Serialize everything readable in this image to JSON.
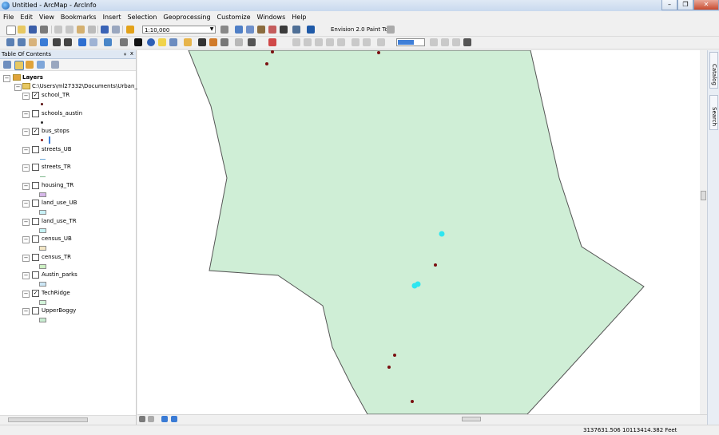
{
  "window": {
    "title": "Untitled - ArcMap - ArcInfo",
    "minimize": "–",
    "restore": "❐",
    "close": "✕"
  },
  "menu": [
    "File",
    "Edit",
    "View",
    "Bookmarks",
    "Insert",
    "Selection",
    "Geoprocessing",
    "Customize",
    "Windows",
    "Help"
  ],
  "toolbar": {
    "scale": "1:10,000",
    "paint_tool_label": "Envision 2.0 Paint Tool",
    "paint_color": "#3f7fd8"
  },
  "toc": {
    "title": "Table Of Contents",
    "pin": "ᵩ",
    "close": "x",
    "root": "Layers",
    "folder_path": "C:\\Users\\ml27332\\Documents\\Urban_F",
    "layers": [
      {
        "name": "school_TR",
        "checked": true,
        "symbol": "point",
        "color": "#5a0f0f"
      },
      {
        "name": "schools_austin",
        "checked": false,
        "symbol": "point",
        "color": "#2a2a2a"
      },
      {
        "name": "bus_stops",
        "checked": true,
        "symbol": "point",
        "color": "#8b1a1a"
      },
      {
        "name": "streets_UB",
        "checked": false,
        "symbol": "line",
        "color": "#6aa7d8"
      },
      {
        "name": "streets_TR",
        "checked": false,
        "symbol": "line",
        "color": "#7fb98d"
      },
      {
        "name": "housing_TR",
        "checked": false,
        "symbol": "fill",
        "color": "#d7b8ea"
      },
      {
        "name": "land_use_UB",
        "checked": false,
        "symbol": "fill",
        "color": "#c7f0f6"
      },
      {
        "name": "land_use_TR",
        "checked": false,
        "symbol": "fill",
        "color": "#c4f2f4"
      },
      {
        "name": "census_UB",
        "checked": false,
        "symbol": "fill",
        "color": "#f3e6c5"
      },
      {
        "name": "census_TR",
        "checked": false,
        "symbol": "fill",
        "color": "#cdf0c3"
      },
      {
        "name": "Austin_parks",
        "checked": false,
        "symbol": "fill",
        "color": "#cce6f5"
      },
      {
        "name": "TechRidge",
        "checked": true,
        "symbol": "fill",
        "color": "#d2f3d9"
      },
      {
        "name": "UpperBoggy",
        "checked": false,
        "symbol": "fill",
        "color": "#c7ecd0"
      }
    ]
  },
  "map": {
    "polygon_fill": "#cfeed6",
    "polygon_stroke": "#555555",
    "point_color": "#7a1010",
    "bus_stop_color": "#2ee6f0"
  },
  "dock": {
    "catalog": "Catalog",
    "search": "Search"
  },
  "status": {
    "coordinates": "3137631.506  10113414.382 Feet"
  }
}
